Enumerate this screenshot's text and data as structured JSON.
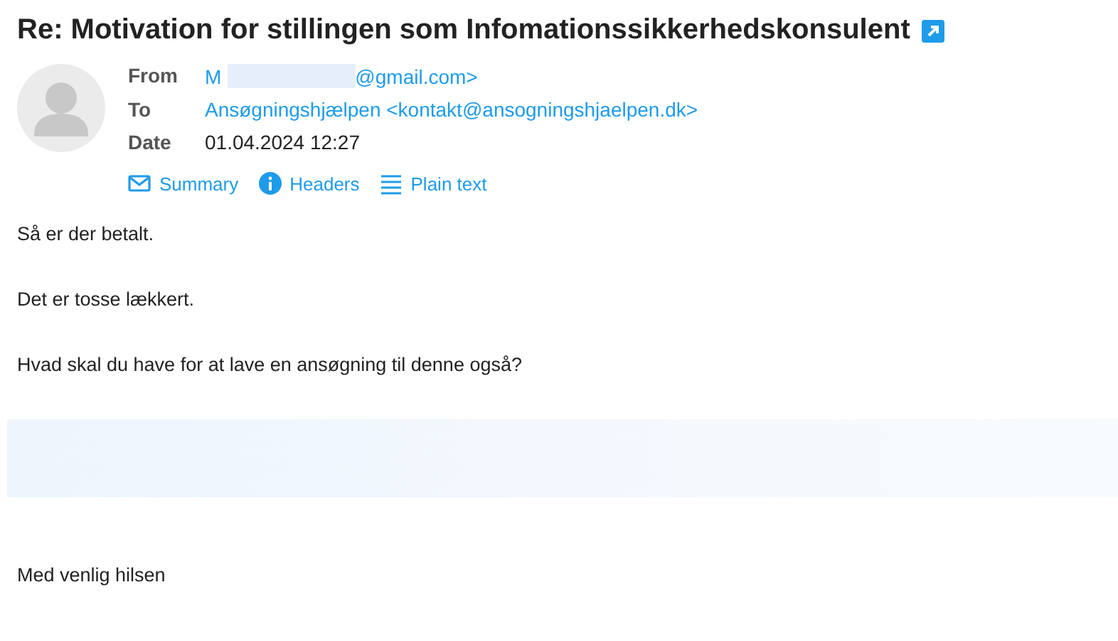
{
  "subject": {
    "title": "Re: Motivation for stillingen som Infomationssikkerhedskonsulent"
  },
  "headers": [
    {
      "label": "From",
      "kind": "link",
      "value": "M",
      "value_after": "@gmail.com>"
    },
    {
      "label": "To",
      "kind": "link",
      "value": "Ansøgningshjælpen <kontakt@ansogningshjaelpen.dk>"
    },
    {
      "label": "Date",
      "kind": "text",
      "value": "01.04.2024 12:27"
    }
  ],
  "views": [
    {
      "label": "Summary",
      "kind": "summary"
    },
    {
      "label": "Headers",
      "kind": "headers"
    },
    {
      "label": "Plain text",
      "kind": "plain"
    }
  ],
  "body": [
    {
      "kind": "text",
      "text": "Så er der betalt."
    },
    {
      "kind": "text",
      "text": "Det er tosse lækkert."
    },
    {
      "kind": "text",
      "text": "Hvad skal du have for at lave en ansøgning til denne også?"
    },
    {
      "kind": "redacted"
    },
    {
      "kind": "text",
      "text": "Med venlig hilsen"
    }
  ]
}
